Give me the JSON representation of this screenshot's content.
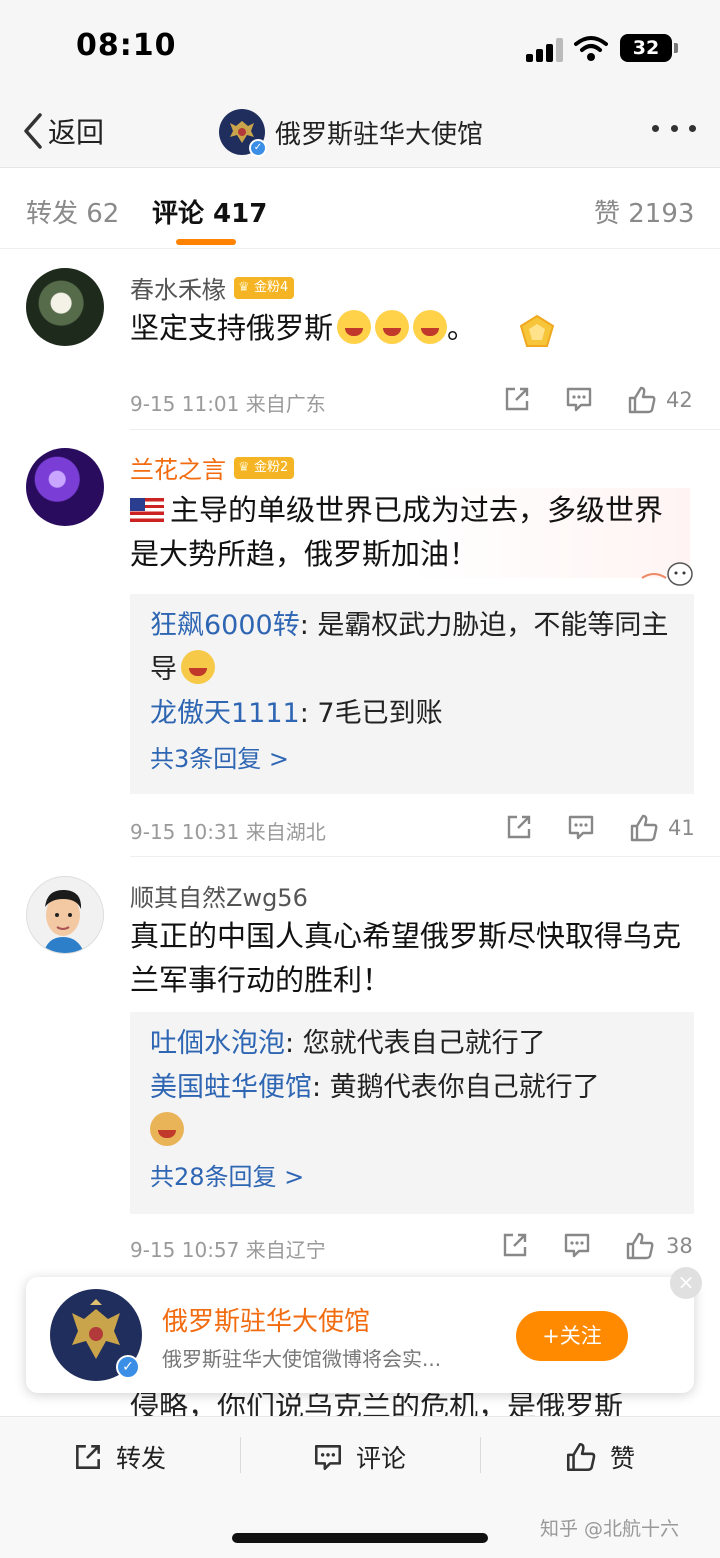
{
  "status_bar": {
    "time": "08:10",
    "battery": "32"
  },
  "nav": {
    "back_label": "返回",
    "title": "俄罗斯驻华大使馆"
  },
  "tabs": [
    {
      "label": "转发 62"
    },
    {
      "label": "评论 417"
    },
    {
      "label": "赞 2193"
    }
  ],
  "comments": [
    {
      "user": "春水禾椽",
      "badge": "金粉4",
      "text": "坚定支持俄罗斯",
      "text_suffix": "。",
      "meta": "9-15 11:01 来自广东",
      "likes": "42"
    },
    {
      "user": "兰花之言",
      "badge": "金粉2",
      "text": "主导的单级世界已成为过去，多级世界是大势所趋，俄罗斯加油！",
      "replies": [
        {
          "user": "狂飙6000转",
          "text": ": 是霸权武力胁迫，不能等同主导"
        },
        {
          "user": "龙傲天1111",
          "text": ": 7毛已到账"
        }
      ],
      "more_replies": "共3条回复 >",
      "meta": "9-15 10:31 来自湖北",
      "likes": "41"
    },
    {
      "user": "顺其自然Zwg56",
      "text": "真正的中国人真心希望俄罗斯尽快取得乌克兰军事行动的胜利！",
      "replies": [
        {
          "user": "吐個水泡泡",
          "text": ": 您就代表自己就行了"
        },
        {
          "user": "美国蛀华便馆",
          "text": ": 黄鹅代表你自己就行了"
        }
      ],
      "more_replies": "共28条回复 >",
      "meta": "9-15 10:57 来自辽宁",
      "likes": "38"
    }
  ],
  "follow_card": {
    "name": "俄罗斯驻华大使馆",
    "desc": "俄罗斯驻华大使馆微博将会实...",
    "button": "+关注"
  },
  "behind_text": "侵略，你们说乌克兰的危机，是俄罗斯",
  "bottom_bar": {
    "repost": "转发",
    "comment": "评论",
    "like": "赞"
  },
  "watermark": "知乎 @北航十六",
  "colors": {
    "accent": "#ff8200",
    "reply_user": "#2e66b3",
    "name_orange": "#f26b0f"
  }
}
